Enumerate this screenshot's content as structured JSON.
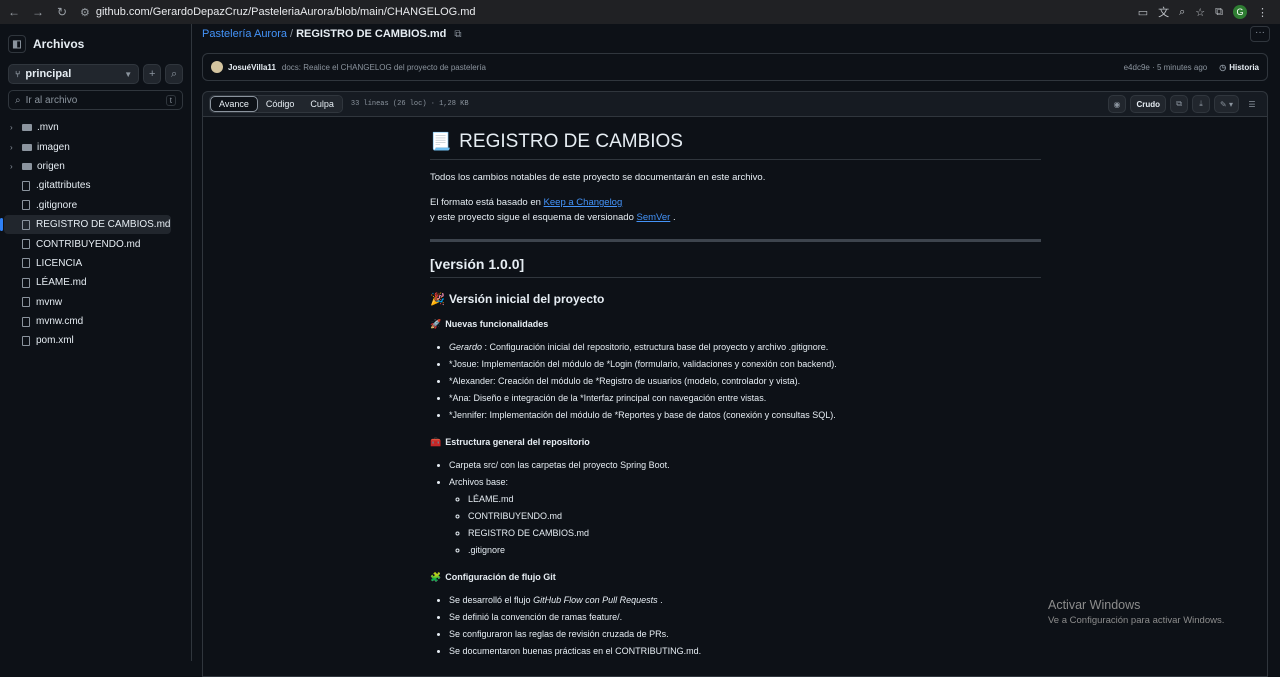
{
  "browser": {
    "url": "github.com/GerardoDepazCruz/PasteleriaAurora/blob/main/CHANGELOG.md",
    "profile_initial": "G"
  },
  "sidebar": {
    "title": "Archivos",
    "branch": "principal",
    "goto_placeholder": "Ir al archivo",
    "goto_shortcut": "t",
    "items": [
      {
        "label": ".mvn",
        "kind": "folder"
      },
      {
        "label": "imagen",
        "kind": "folder"
      },
      {
        "label": "origen",
        "kind": "folder"
      },
      {
        "label": ".gitattributes",
        "kind": "file"
      },
      {
        "label": ".gitignore",
        "kind": "file"
      },
      {
        "label": "REGISTRO DE CAMBIOS.md",
        "kind": "file",
        "selected": true
      },
      {
        "label": "CONTRIBUYENDO.md",
        "kind": "file"
      },
      {
        "label": "LICENCIA",
        "kind": "file"
      },
      {
        "label": "LÉAME.md",
        "kind": "file"
      },
      {
        "label": "mvnw",
        "kind": "file"
      },
      {
        "label": "mvnw.cmd",
        "kind": "file"
      },
      {
        "label": "pom.xml",
        "kind": "file"
      }
    ]
  },
  "breadcrumb": {
    "repo": "Pastelería Aurora",
    "sep": "/",
    "file": "REGISTRO DE CAMBIOS.md"
  },
  "commit": {
    "author": "JosuéVilla11",
    "message": "docs: Realice el CHANGELOG del proyecto de pastelería",
    "meta": "e4dc9e · 5 minutes ago",
    "history": "Historia"
  },
  "file_header": {
    "tabs": [
      "Avance",
      "Código",
      "Culpa"
    ],
    "stats": "33 líneas (26 loc) · 1,28 KB",
    "raw": "Crudo"
  },
  "doc": {
    "title": "REGISTRO DE CAMBIOS",
    "title_emoji": "📃",
    "intro": "Todos los cambios notables de este proyecto se documentarán en este archivo.",
    "format_pre": "El formato está basado en",
    "format_link": "Keep a Changelog",
    "semver_pre": "y este proyecto sigue el esquema de versionado",
    "semver_link": "SemVer",
    "semver_post": ".",
    "version": "[versión 1.0.0]",
    "version_sub_emoji": "🎉",
    "version_sub": "Versión inicial del proyecto",
    "sec1_emoji": "🚀",
    "sec1": "Nuevas funcionalidades",
    "features": [
      {
        "name": "Gerardo",
        "text": " : Configuración inicial del repositorio, estructura base del proyecto y archivo .gitignore."
      },
      {
        "name": "",
        "text": "*Josue: Implementación del módulo de *Login (formulario, validaciones y conexión con backend)."
      },
      {
        "name": "",
        "text": "*Alexander: Creación del módulo de *Registro de usuarios (modelo, controlador y vista)."
      },
      {
        "name": "",
        "text": "*Ana: Diseño e integración de la *Interfaz principal con navegación entre vistas."
      },
      {
        "name": "",
        "text": "*Jennifer: Implementación del módulo de *Reportes y base de datos (conexión y consultas SQL)."
      }
    ],
    "sec2_emoji": "🧰",
    "sec2": "Estructura general del repositorio",
    "struct_1": "Carpeta src/ con las carpetas del proyecto Spring Boot.",
    "struct_2": "Archivos base:",
    "base_files": [
      "LÉAME.md",
      "CONTRIBUYENDO.md",
      "REGISTRO DE CAMBIOS.md",
      ".gitignore"
    ],
    "sec3_emoji": "🧩",
    "sec3": "Configuración de flujo Git",
    "git_1_pre": "Se desarrolló el flujo",
    "git_1_em": "GitHub Flow con Pull Requests",
    "git_1_post": ".",
    "git_2": "Se definió la convención de ramas feature/.",
    "git_3": "Se configuraron las reglas de revisión cruzada de PRs.",
    "git_4": "Se documentaron buenas prácticas en el CONTRIBUTING.md."
  },
  "watermark": {
    "line1": "Activar Windows",
    "line2": "Ve a Configuración para activar Windows."
  }
}
